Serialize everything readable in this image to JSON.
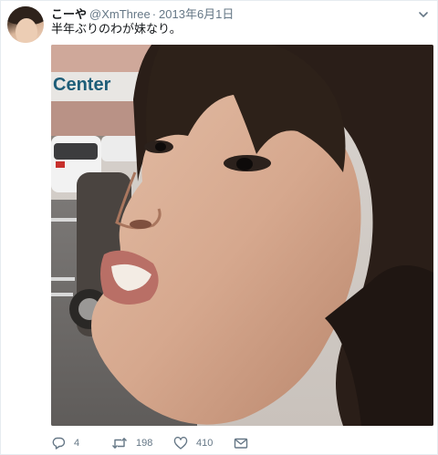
{
  "tweet": {
    "display_name": "こーや",
    "handle": "@XmThree",
    "separator": "·",
    "timestamp": "2013年6月1日",
    "text": "半年ぶりのわが妹なり。",
    "media": {
      "sign_text": "Center"
    }
  },
  "actions": {
    "reply_icon": "reply-icon",
    "reply_count": "4",
    "retweet_icon": "retweet-icon",
    "retweet_count": "198",
    "like_icon": "heart-icon",
    "like_count": "410",
    "dm_icon": "envelope-icon"
  },
  "colors": {
    "text_primary": "#14171a",
    "text_secondary": "#657786",
    "border": "#e6ecf0"
  }
}
